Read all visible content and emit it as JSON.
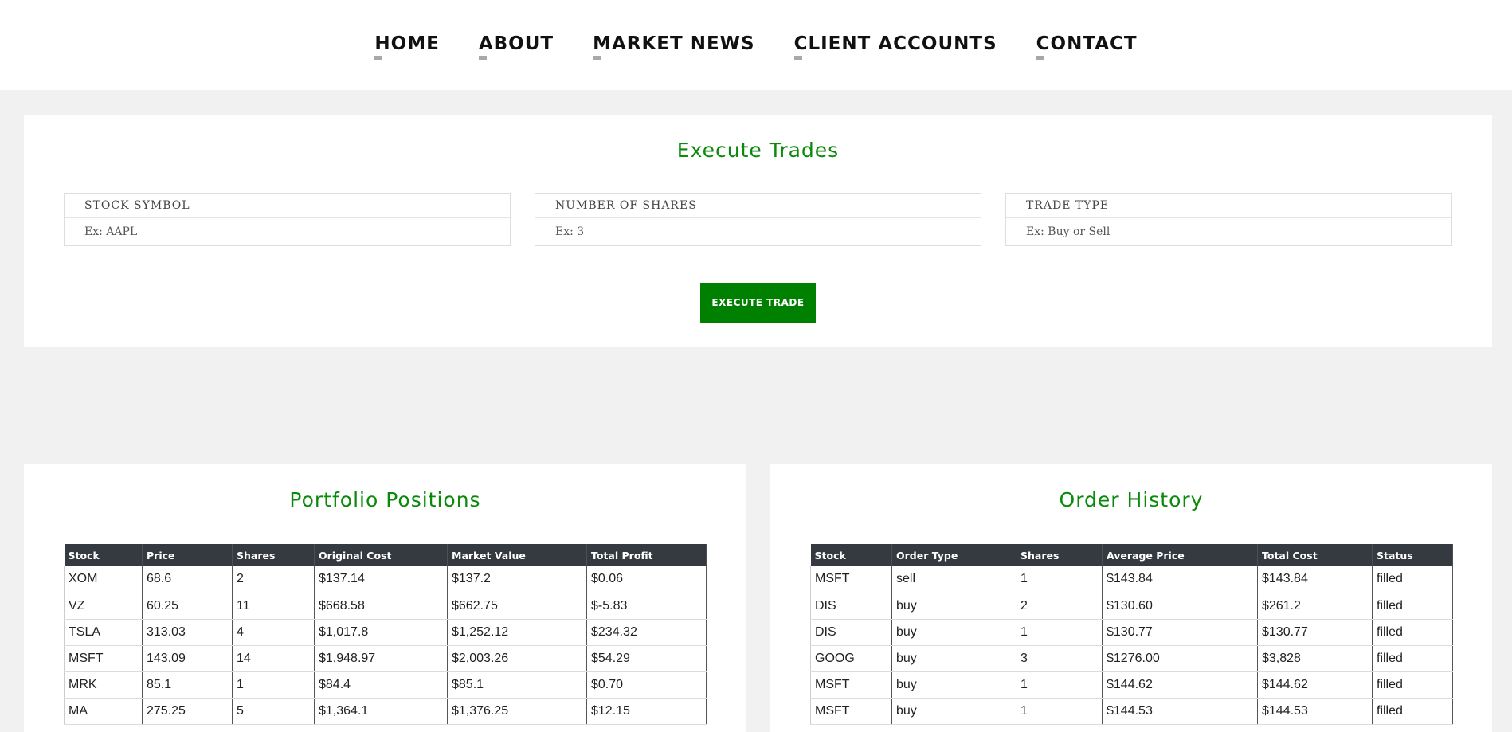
{
  "nav": {
    "items": [
      "HOME",
      "ABOUT",
      "MARKET NEWS",
      "CLIENT ACCOUNTS",
      "CONTACT"
    ]
  },
  "trade_form": {
    "title": "Execute Trades",
    "fields": [
      {
        "label": "STOCK SYMBOL",
        "placeholder": "Ex: AAPL"
      },
      {
        "label": "NUMBER OF SHARES",
        "placeholder": "Ex: 3"
      },
      {
        "label": "TRADE TYPE",
        "placeholder": "Ex: Buy or Sell"
      }
    ],
    "button_label": "EXECUTE TRADE"
  },
  "portfolio": {
    "title": "Portfolio Positions",
    "columns": [
      "Stock",
      "Price",
      "Shares",
      "Original Cost",
      "Market Value",
      "Total Profit"
    ],
    "rows": [
      [
        "XOM",
        "68.6",
        "2",
        "$137.14",
        "$137.2",
        "$0.06"
      ],
      [
        "VZ",
        "60.25",
        "11",
        "$668.58",
        "$662.75",
        "$-5.83"
      ],
      [
        "TSLA",
        "313.03",
        "4",
        "$1,017.8",
        "$1,252.12",
        "$234.32"
      ],
      [
        "MSFT",
        "143.09",
        "14",
        "$1,948.97",
        "$2,003.26",
        "$54.29"
      ],
      [
        "MRK",
        "85.1",
        "1",
        "$84.4",
        "$85.1",
        "$0.70"
      ],
      [
        "MA",
        "275.25",
        "5",
        "$1,364.1",
        "$1,376.25",
        "$12.15"
      ]
    ]
  },
  "order_history": {
    "title": "Order History",
    "columns": [
      "Stock",
      "Order Type",
      "Shares",
      "Average Price",
      "Total Cost",
      "Status"
    ],
    "rows": [
      [
        "MSFT",
        "sell",
        "1",
        "$143.84",
        "$143.84",
        "filled"
      ],
      [
        "DIS",
        "buy",
        "2",
        "$130.60",
        "$261.2",
        "filled"
      ],
      [
        "DIS",
        "buy",
        "1",
        "$130.77",
        "$130.77",
        "filled"
      ],
      [
        "GOOG",
        "buy",
        "3",
        "$1276.00",
        "$3,828",
        "filled"
      ],
      [
        "MSFT",
        "buy",
        "1",
        "$144.62",
        "$144.62",
        "filled"
      ],
      [
        "MSFT",
        "buy",
        "1",
        "$144.53",
        "$144.53",
        "filled"
      ]
    ]
  },
  "colors": {
    "accent_green": "#0a8a0a",
    "button_green": "#008000",
    "table_header": "#343a40",
    "page_bg": "#f1f1f1"
  }
}
